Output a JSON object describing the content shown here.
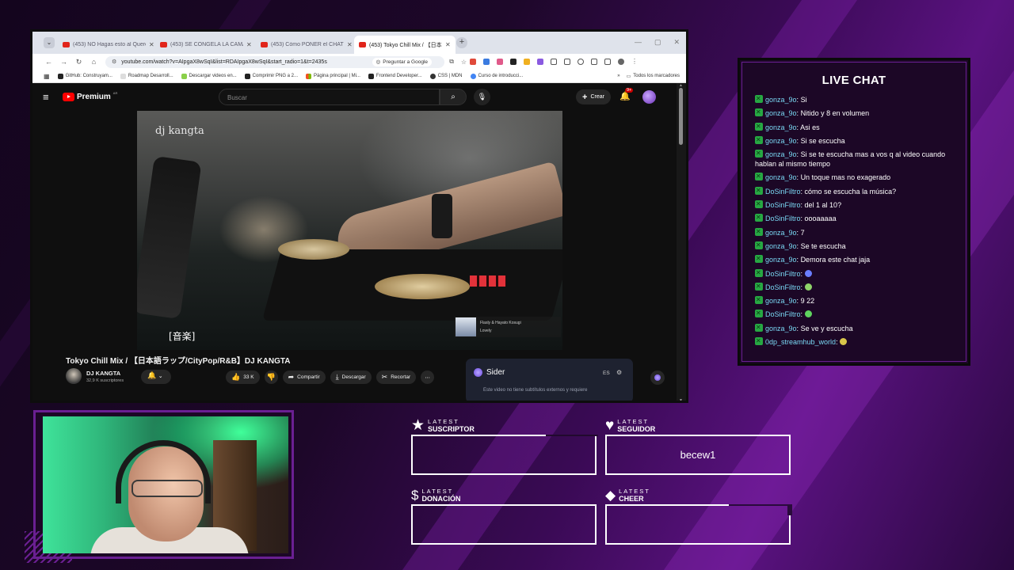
{
  "browser": {
    "tabs": [
      {
        "title": "(453) NO Hagas esto al Querer",
        "active": false
      },
      {
        "title": "(453) SE CONGELA LA CÁMARA",
        "active": false
      },
      {
        "title": "(453) Cómo PONER el CHAT de",
        "active": false
      },
      {
        "title": "(453) Tokyo Chill Mix / 【日本",
        "active": true
      }
    ],
    "url": "youtube.com/watch?v=AIpgaX8wSqI&list=RDAIpgaX8wSqI&start_radio=1&t=2435s",
    "ask_google": "Preguntar a Google",
    "bookmarks": [
      "GitHub: Construyam...",
      "Roadmap Desarroll...",
      "Descargar videos en...",
      "Comprimir PNG a 2...",
      "Página principal | Mi...",
      "Frontend Developer...",
      "CSS | MDN",
      "Curso de introducci..."
    ],
    "bookmarks_all": "Todos los marcadores"
  },
  "youtube": {
    "logo_word": "Premium",
    "logo_region": "AR",
    "search_placeholder": "Buscar",
    "create_label": "Crear",
    "notif_count": "9+",
    "video_brand": "dj kangta",
    "caption": "[音楽]",
    "now_playing": {
      "artist": "Flasly & Hayato Kosugi",
      "track": "Lovely"
    },
    "title": "Tokyo Chill Mix / 【日本語ラップ/CityPop/R&B】DJ KANGTA",
    "channel_name": "DJ KANGTA",
    "channel_subs": "32,9 K suscriptores",
    "likes": "33 K",
    "share_label": "Compartir",
    "download_label": "Descargar",
    "clip_label": "Recortar",
    "sider": {
      "name": "Sider",
      "lang": "ES",
      "note": "Este video no tiene subtítulos externos y requiere"
    }
  },
  "chat": {
    "title": "LIVE CHAT",
    "messages": [
      {
        "user": "gonza_9o",
        "text": "Si"
      },
      {
        "user": "gonza_9o",
        "text": "Nitido y 8 en volumen"
      },
      {
        "user": "gonza_9o",
        "text": "Asi es"
      },
      {
        "user": "gonza_9o",
        "text": "Si se escucha"
      },
      {
        "user": "gonza_9o",
        "text": "Si se te escucha mas a vos q al video cuando hablan al mismo tiempo"
      },
      {
        "user": "gonza_9o",
        "text": "Un toque mas no exagerado"
      },
      {
        "user": "DoSinFiltro",
        "text": "cómo se escucha la música?"
      },
      {
        "user": "DoSinFiltro",
        "text": "del 1 al 10?"
      },
      {
        "user": "DoSinFiltro",
        "text": "oooaaaaa"
      },
      {
        "user": "gonza_9o",
        "text": "7"
      },
      {
        "user": "gonza_9o",
        "text": "Se te escucha"
      },
      {
        "user": "gonza_9o",
        "text": "Demora este chat jaja"
      },
      {
        "user": "DoSinFiltro",
        "text": "",
        "emote": "#6a7dff"
      },
      {
        "user": "DoSinFiltro",
        "text": "",
        "emote": "#8fd36a"
      },
      {
        "user": "gonza_9o",
        "text": "9 22"
      },
      {
        "user": "DoSinFiltro",
        "text": "",
        "emote": "#5fd35f"
      },
      {
        "user": "gonza_9o",
        "text": "Se ve y escucha"
      },
      {
        "user": "0dp_streamhub_world",
        "text": "",
        "emote": "#d8c64a"
      }
    ]
  },
  "latest": {
    "suscriptor": {
      "kicker": "LATEST",
      "label": "SUSCRIPTOR",
      "value": "",
      "icon": "star-icon"
    },
    "seguidor": {
      "kicker": "LATEST",
      "label": "SEGUIDOR",
      "value": "becew1",
      "icon": "heart-icon"
    },
    "donacion": {
      "kicker": "LATEST",
      "label": "DONACIÓN",
      "value": "",
      "icon": "dollar-icon"
    },
    "cheer": {
      "kicker": "LATEST",
      "label": "CHEER",
      "value": "",
      "icon": "diamond-icon"
    }
  },
  "colors": {
    "accent": "#6a1f92",
    "chat_user": "#7ad9f5",
    "badge": "#27a843",
    "yt_red": "#ff0000"
  }
}
